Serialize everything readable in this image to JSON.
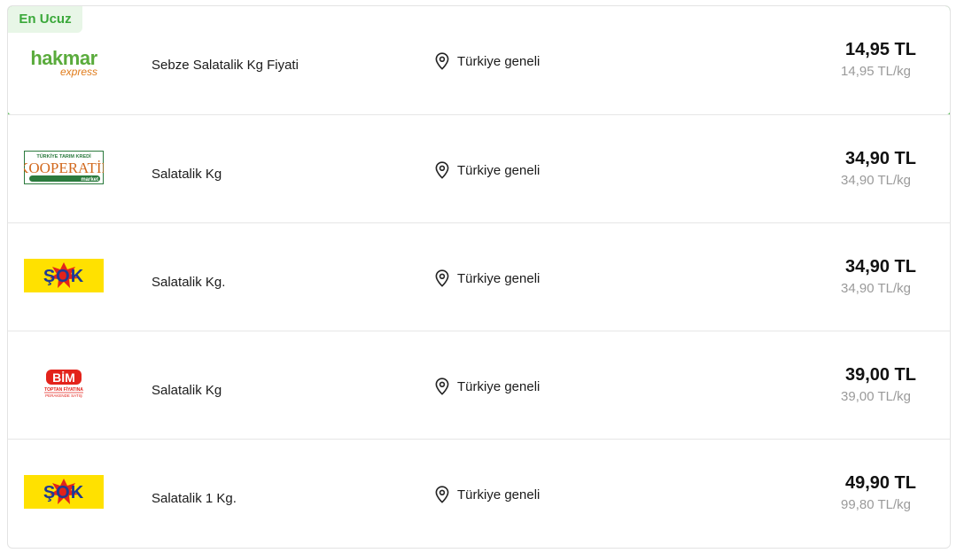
{
  "badge": {
    "label": "En Ucuz",
    "color": "#3aa83a"
  },
  "offers": [
    {
      "store_logo": "hakmar-express-logo",
      "logo_text": [
        "hakmar",
        "express"
      ],
      "product": "Sebze Salatalik Kg Fiyati",
      "location": "Türkiye geneli",
      "price": "14,95 TL",
      "unit_price": "14,95 TL/kg"
    },
    {
      "store_logo": "tarim-kredi-kooperatif-logo",
      "logo_text": [
        "TÜRKİYE TARIM KREDİ",
        "KOOPERATİF",
        "market"
      ],
      "product": "Salatalik Kg",
      "location": "Türkiye geneli",
      "price": "34,90 TL",
      "unit_price": "34,90 TL/kg"
    },
    {
      "store_logo": "sok-logo",
      "logo_text": [
        "ŞOK"
      ],
      "product": "Salatalik Kg.",
      "location": "Türkiye geneli",
      "price": "34,90 TL",
      "unit_price": "34,90 TL/kg"
    },
    {
      "store_logo": "bim-logo",
      "logo_text": [
        "BİM",
        "TOPTAN FİYATINA",
        "PERAKENDE SATIŞ"
      ],
      "product": "Salatalik Kg",
      "location": "Türkiye geneli",
      "price": "39,00 TL",
      "unit_price": "39,00 TL/kg"
    },
    {
      "store_logo": "sok-logo",
      "logo_text": [
        "ŞOK"
      ],
      "product": "Salatalik 1 Kg.",
      "location": "Türkiye geneli",
      "price": "49,90 TL",
      "unit_price": "99,80 TL/kg"
    }
  ],
  "colors": {
    "accent_green": "#4cb84a",
    "muted_text": "#9a9a9a",
    "sok_yellow": "#ffe100",
    "bim_red": "#e3231b"
  }
}
